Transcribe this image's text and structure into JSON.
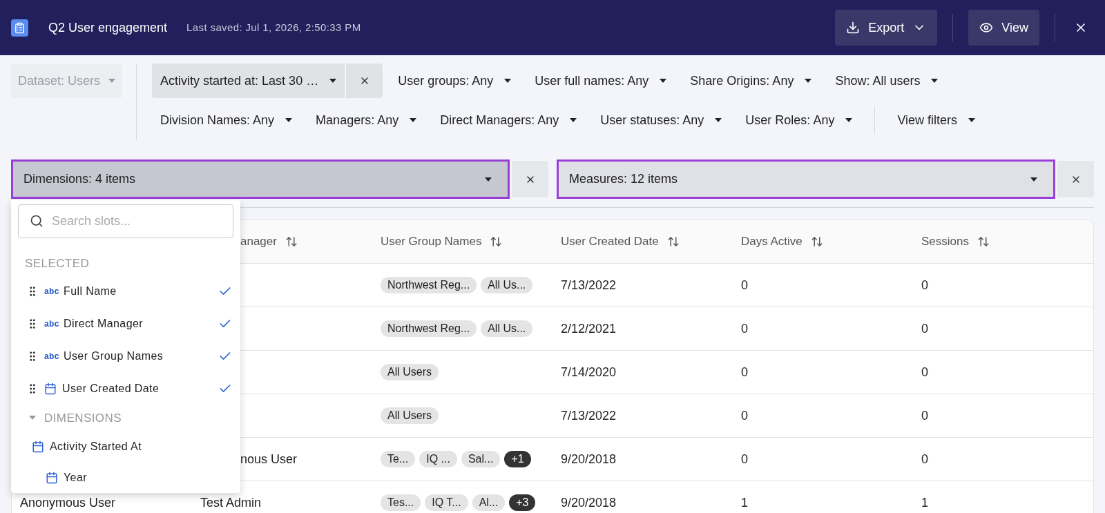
{
  "header": {
    "title": "Q2 User engagement",
    "last_saved": "Last saved: Jul 1, 2026, 2:50:33 PM",
    "buttons": [
      {
        "label": "Export",
        "kind": "export"
      },
      {
        "label": "View",
        "kind": "view"
      }
    ]
  },
  "dataset": {
    "label": "Dataset: Users",
    "disabled": true
  },
  "filter_rows": [
    {
      "filters": [
        {
          "label": "Activity started at: Last 30 …",
          "removable": true
        },
        {
          "label": "User groups: Any",
          "removable": false
        },
        {
          "label": "User full names: Any",
          "removable": false
        },
        {
          "label": "Share Origins: Any",
          "removable": false
        },
        {
          "label": "Show: All users",
          "removable": false
        }
      ]
    },
    {
      "filters": [
        {
          "label": "Division Names: Any",
          "removable": false
        },
        {
          "label": "Managers: Any",
          "removable": false
        },
        {
          "label": "Direct Managers: Any",
          "removable": false
        },
        {
          "label": "User statuses: Any",
          "removable": false
        },
        {
          "label": "User Roles: Any",
          "removable": false
        }
      ]
    }
  ],
  "view_filters": {
    "label": "View filters"
  },
  "slots": [
    {
      "label": "Dimensions: 4 items",
      "open": true
    },
    {
      "label": "Measures: 12 items",
      "open": false
    }
  ],
  "dropdown": {
    "placeholder": "Search slots...",
    "selected_heading": "SELECTED",
    "selected": [
      {
        "label": "Full Name",
        "kind": "text",
        "type_label": "abc",
        "checked": true
      },
      {
        "label": "Direct Manager",
        "kind": "text",
        "type_label": "abc",
        "checked": true
      },
      {
        "label": "User Group Names",
        "kind": "text",
        "type_label": "abc",
        "checked": true
      },
      {
        "label": "User Created Date",
        "kind": "date",
        "checked": true
      }
    ],
    "group": {
      "label": "DIMENSIONS",
      "expanded": true,
      "children": [
        {
          "label": "Activity Started At",
          "kind": "date",
          "children": [
            {
              "label": "Year",
              "kind": "date"
            }
          ]
        }
      ]
    }
  },
  "table": {
    "columns": [
      {
        "label": "anager"
      },
      {
        "label": "User Group Names"
      },
      {
        "label": "User Created Date"
      },
      {
        "label": "Days Active"
      },
      {
        "label": "Sessions"
      }
    ],
    "rows": [
      {
        "groups": [
          {
            "label": "Northwest Reg...",
            "kind": "tag"
          },
          {
            "label": "All Us...",
            "kind": "tag"
          }
        ],
        "created_date": "7/13/2022",
        "days_active": "0",
        "sessions": "0"
      },
      {
        "groups": [
          {
            "label": "Northwest Reg...",
            "kind": "tag"
          },
          {
            "label": "All Us...",
            "kind": "tag"
          }
        ],
        "created_date": "2/12/2021",
        "days_active": "0",
        "sessions": "0"
      },
      {
        "groups": [
          {
            "label": "All Users",
            "kind": "tag"
          }
        ],
        "created_date": "7/14/2020",
        "days_active": "0",
        "sessions": "0"
      },
      {
        "groups": [
          {
            "label": "All Users",
            "kind": "tag"
          }
        ],
        "created_date": "7/13/2022",
        "days_active": "0",
        "sessions": "0"
      },
      {
        "column_2": "nous User",
        "groups": [
          {
            "label": "Te...",
            "kind": "tag"
          },
          {
            "label": "IQ ...",
            "kind": "tag"
          },
          {
            "label": "Sal...",
            "kind": "tag"
          },
          {
            "label": "+1",
            "kind": "more"
          }
        ],
        "created_date": "9/20/2018",
        "days_active": "0",
        "sessions": "0"
      },
      {
        "column_1": "Anonymous User",
        "column_2": "Test Admin",
        "groups": [
          {
            "label": "Tes...",
            "kind": "tag"
          },
          {
            "label": "IQ T...",
            "kind": "tag"
          },
          {
            "label": "Al...",
            "kind": "tag"
          },
          {
            "label": "+3",
            "kind": "more"
          }
        ],
        "created_date": "9/20/2018",
        "days_active": "1",
        "sessions": "1"
      }
    ]
  }
}
